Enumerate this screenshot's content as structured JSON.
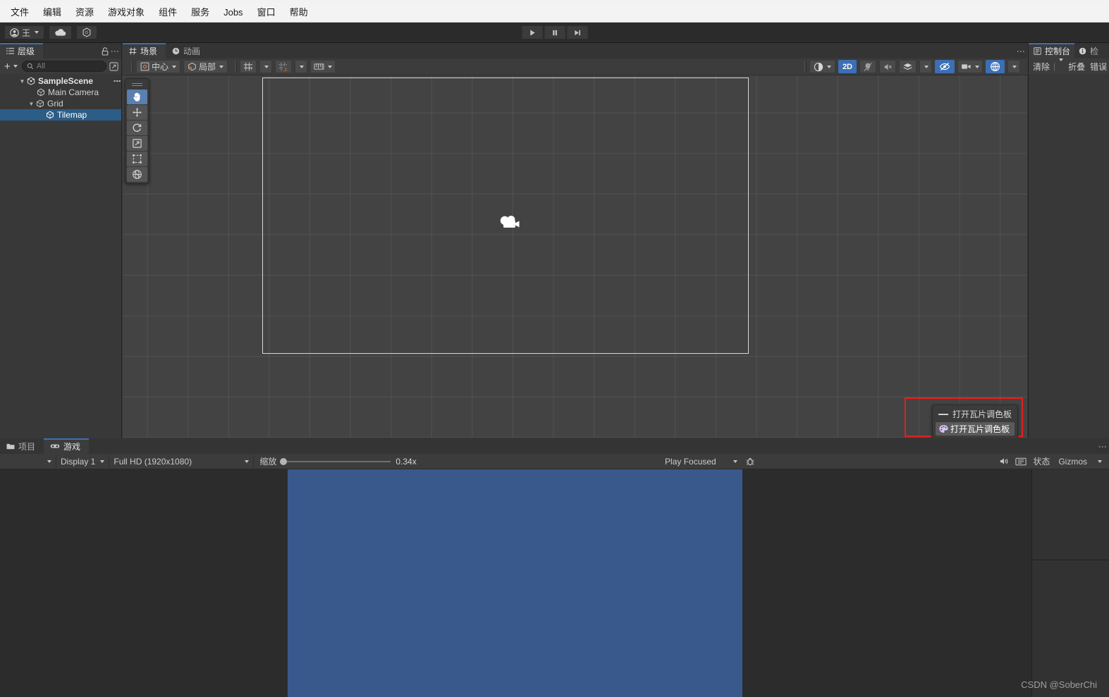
{
  "menubar": {
    "items": [
      {
        "label": "文件",
        "name": "menu-file"
      },
      {
        "label": "编辑",
        "name": "menu-edit"
      },
      {
        "label": "资源",
        "name": "menu-assets"
      },
      {
        "label": "游戏对象",
        "name": "menu-gameobject"
      },
      {
        "label": "组件",
        "name": "menu-component"
      },
      {
        "label": "服务",
        "name": "menu-services"
      },
      {
        "label": "Jobs",
        "name": "menu-jobs"
      },
      {
        "label": "窗口",
        "name": "menu-window"
      },
      {
        "label": "帮助",
        "name": "menu-help"
      }
    ]
  },
  "toolbar": {
    "account_label": "王",
    "account_icon": "person-icon",
    "cloud_icon": "cloud-icon",
    "services_icon": "services-icon",
    "play_icon": "play-icon",
    "pause_icon": "pause-icon",
    "step_icon": "step-icon"
  },
  "hierarchy": {
    "tab_label": "层级",
    "tab_icon": "hierarchy-icon",
    "lock_icon": "lock-icon",
    "menu_icon": "kebab-icon",
    "add_label": "+",
    "search_placeholder": "All",
    "search_value": "",
    "search_icon": "search-icon",
    "expand_icon": "expand-icon",
    "tree": [
      {
        "label": "SampleScene",
        "depth": 0,
        "icon": "scene-icon",
        "expanded": true,
        "selected": false,
        "has_menu": true
      },
      {
        "label": "Main Camera",
        "depth": 1,
        "icon": "gameobject-icon",
        "expanded": null,
        "selected": false,
        "has_menu": false
      },
      {
        "label": "Grid",
        "depth": 1,
        "icon": "gameobject-icon",
        "expanded": true,
        "selected": false,
        "has_menu": false
      },
      {
        "label": "Tilemap",
        "depth": 2,
        "icon": "gameobject-icon",
        "expanded": null,
        "selected": true,
        "has_menu": false
      }
    ]
  },
  "scene": {
    "tabs": [
      {
        "label": "场景",
        "icon": "grid-icon",
        "active": true
      },
      {
        "label": "动画",
        "icon": "clock-icon",
        "active": false
      }
    ],
    "toolbar": {
      "pivot_label": "中心",
      "pivot_icon": "pivot-center-icon",
      "space_label": "局部",
      "space_icon": "space-local-icon",
      "grid_snap_icon": "grid-snap-icon",
      "snap_increment_icon": "snap-increment-icon",
      "ruler_icon": "ruler-icon",
      "shading_icon": "shading-mode-icon",
      "mode_2d_label": "2D",
      "lighting_icon": "lighting-off-icon",
      "audio_icon": "audio-off-icon",
      "fx_icon": "effects-icon",
      "visibility_icon": "scene-visibility-icon",
      "camera_icon": "scene-camera-icon",
      "gizmos_icon": "gizmos-icon"
    },
    "tools": [
      {
        "name": "hand-tool",
        "icon": "hand-icon",
        "active": true
      },
      {
        "name": "move-tool",
        "icon": "move-icon",
        "active": false
      },
      {
        "name": "rotate-tool",
        "icon": "rotate-icon",
        "active": false
      },
      {
        "name": "scale-tool",
        "icon": "scale-icon",
        "active": false
      },
      {
        "name": "rect-tool",
        "icon": "rect-icon",
        "active": false
      },
      {
        "name": "transform-tool",
        "icon": "transform-icon",
        "active": false
      }
    ],
    "camera_gizmo_icon": "camera-gizmo-icon",
    "tile_popup": {
      "menu_label": "打开瓦片调色板",
      "button_label": "打开瓦片调色板",
      "menu_icon": "dash-icon",
      "button_icon": "tile-palette-icon",
      "highlight_color": "#e32020"
    }
  },
  "console": {
    "tabs": [
      {
        "label": "控制台",
        "icon": "console-icon",
        "active": true
      },
      {
        "label": "检",
        "icon": "info-icon",
        "active": false
      }
    ],
    "toolbar": {
      "clear_label": "清除",
      "clear_caret_icon": "chevron-down-icon",
      "collapse_label": "折叠",
      "error_label": "错误"
    }
  },
  "bottom": {
    "tabs": [
      {
        "label": "项目",
        "icon": "folder-icon",
        "active": false
      },
      {
        "label": "游戏",
        "icon": "gamepad-icon",
        "active": true
      }
    ],
    "toolbar": {
      "aspect_blank_caret_icon": "chevron-down-icon",
      "display_label": "Display 1",
      "resolution_label": "Full HD (1920x1080)",
      "scale_label": "缩放",
      "scale_value": "0.34x",
      "scale_percent": 2,
      "play_mode_label": "Play Focused",
      "debug_icon": "bug-icon",
      "mute_icon": "mute-audio-icon",
      "stats_grid_icon": "stats-grid-icon",
      "stats_label": "状态",
      "gizmos_label": "Gizmos",
      "gizmos_caret_icon": "chevron-down-icon"
    },
    "game_render_color": "#39598c"
  },
  "watermark": "CSDN @SoberChi"
}
